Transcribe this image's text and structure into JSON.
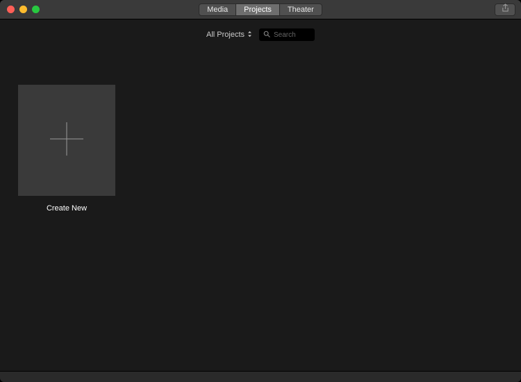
{
  "tabs": {
    "media": "Media",
    "projects": "Projects",
    "theater": "Theater"
  },
  "toolbar": {
    "filter_label": "All Projects",
    "search_placeholder": "Search"
  },
  "content": {
    "create_label": "Create New"
  }
}
